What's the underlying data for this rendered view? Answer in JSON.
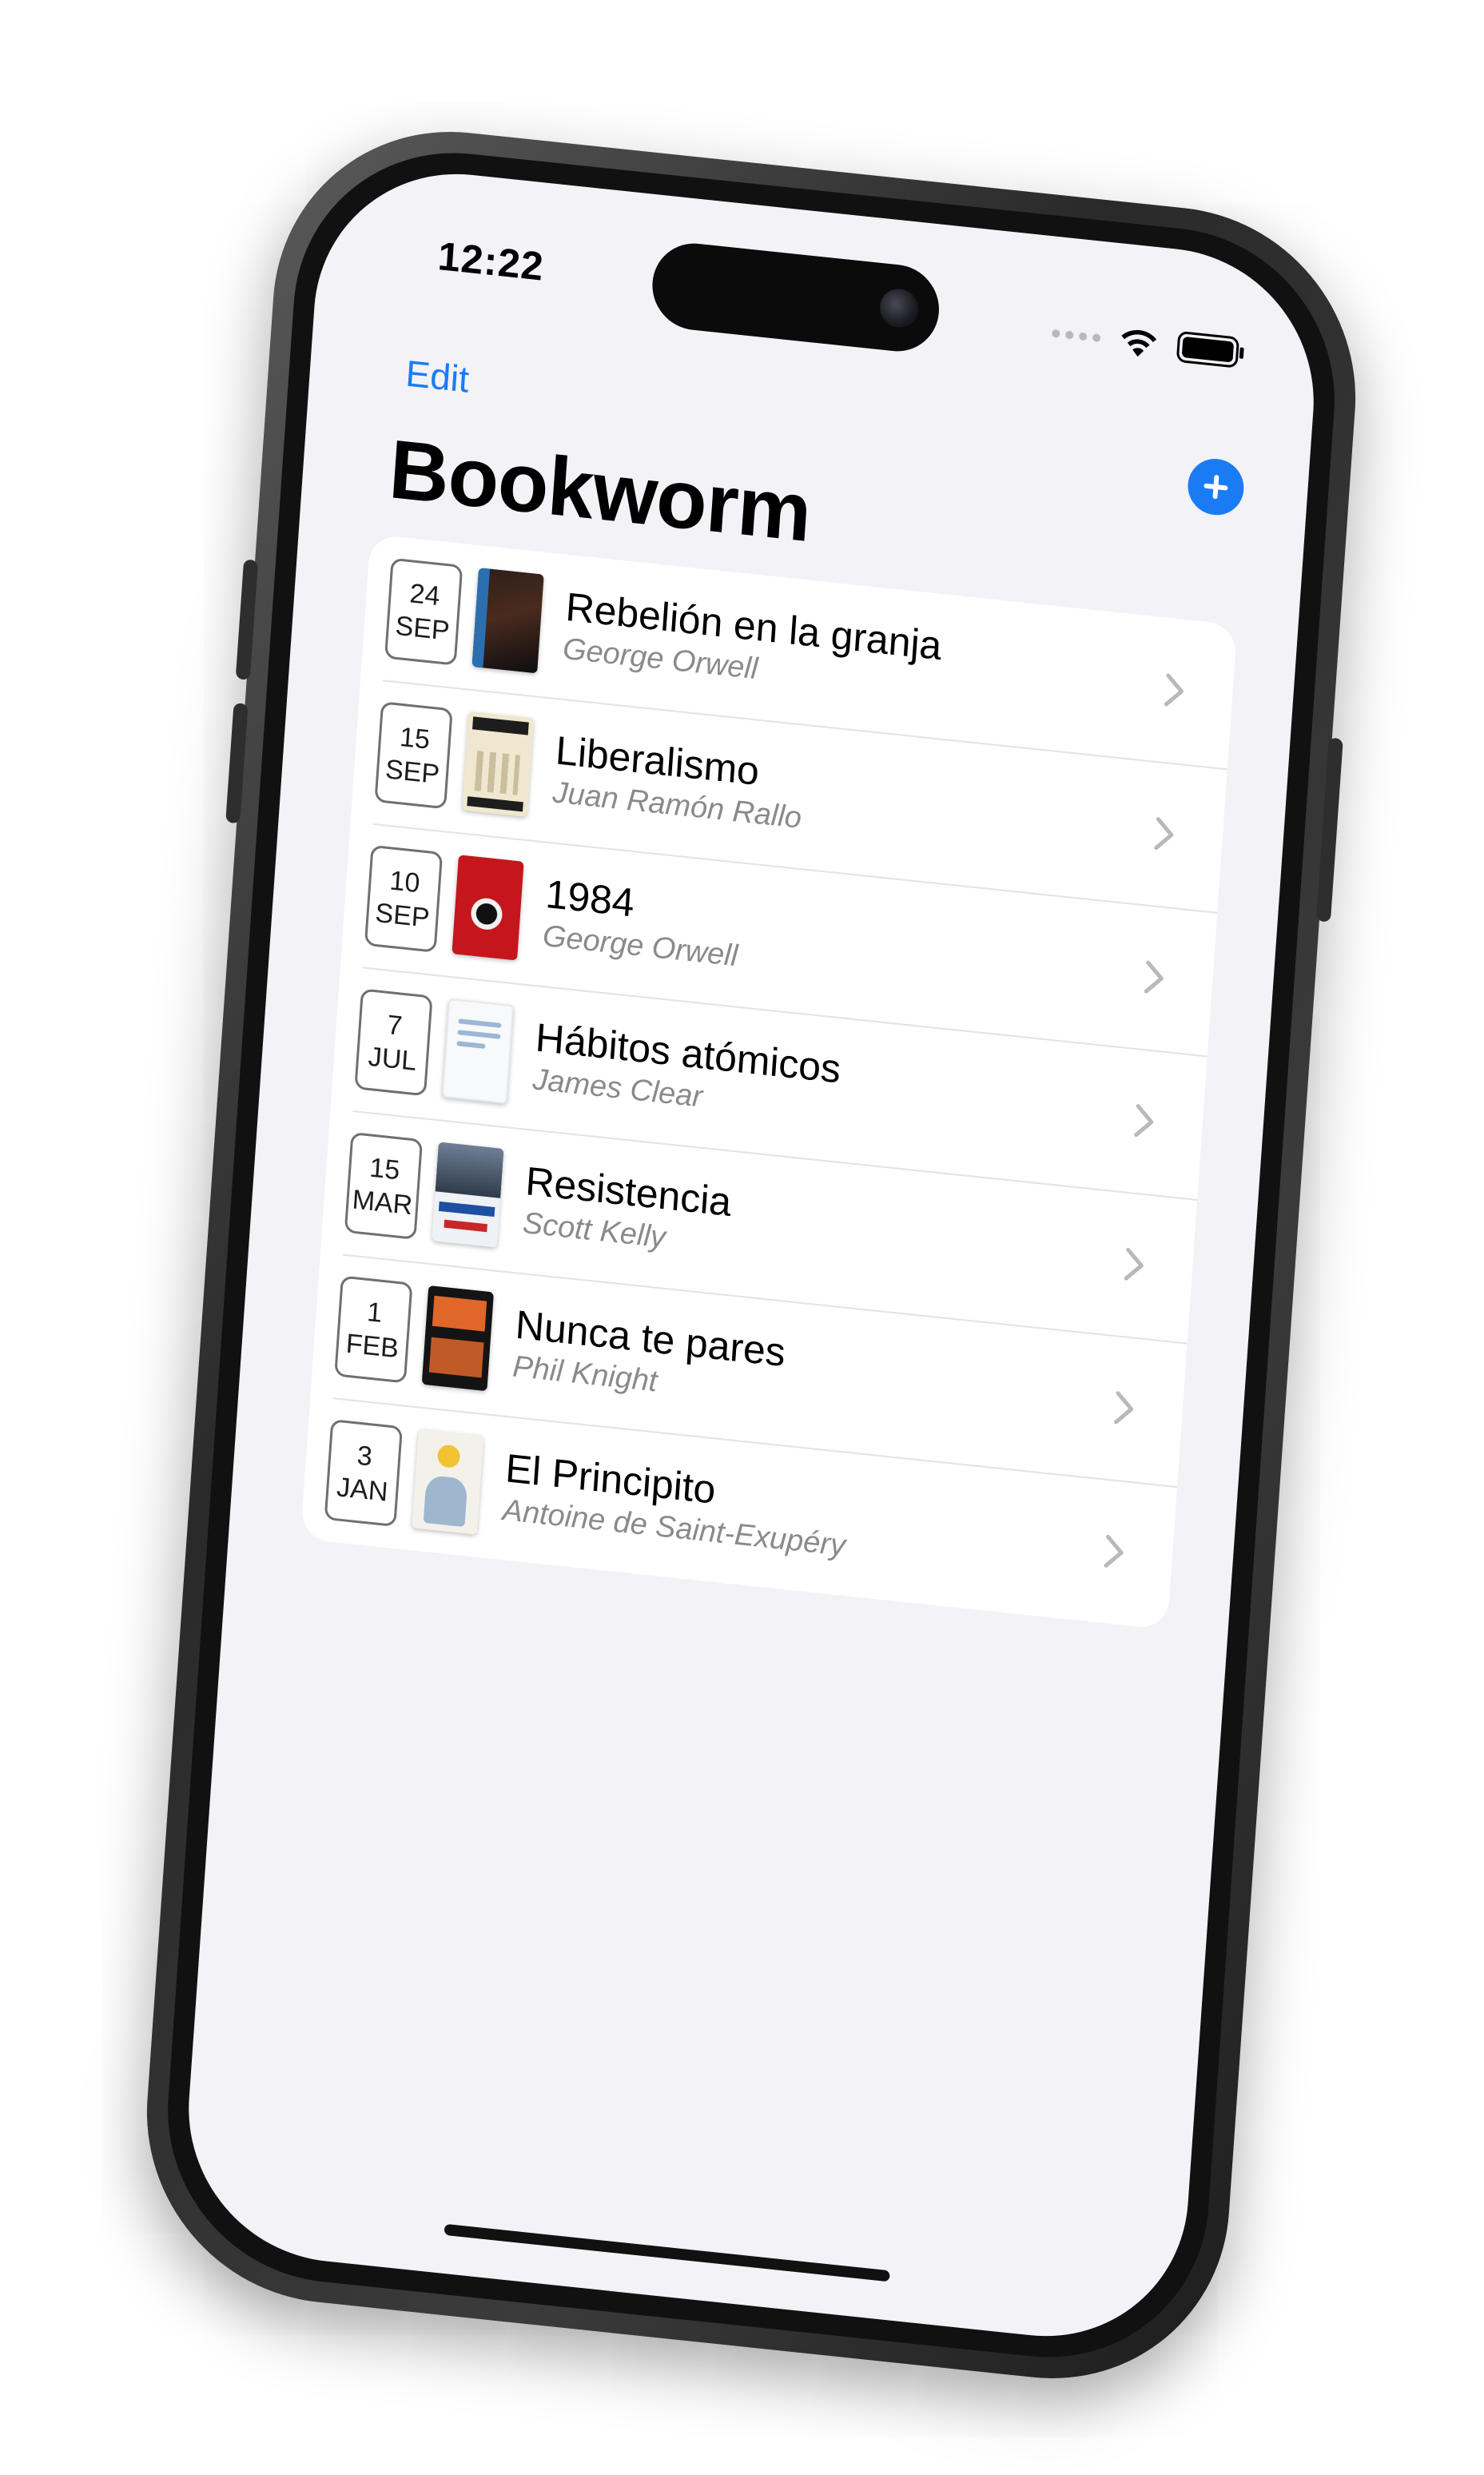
{
  "status_bar": {
    "time": "12:22",
    "signal_icon": "signal-dots-icon",
    "wifi_icon": "wifi-icon",
    "battery_icon": "battery-icon"
  },
  "nav": {
    "edit_label": "Edit",
    "add_icon": "plus-circle-icon",
    "title": "Bookworm"
  },
  "colors": {
    "accent": "#1a7cf5",
    "background": "#f2f2f7",
    "secondary_text": "#8a8a8e"
  },
  "books": [
    {
      "day": "24",
      "month": "SEP",
      "title": "Rebelión en la granja",
      "author": "George Orwell"
    },
    {
      "day": "15",
      "month": "SEP",
      "title": "Liberalismo",
      "author": "Juan Ramón Rallo"
    },
    {
      "day": "10",
      "month": "SEP",
      "title": "1984",
      "author": "George Orwell"
    },
    {
      "day": "7",
      "month": "JUL",
      "title": "Hábitos atómicos",
      "author": "James Clear"
    },
    {
      "day": "15",
      "month": "MAR",
      "title": "Resistencia",
      "author": "Scott Kelly"
    },
    {
      "day": "1",
      "month": "FEB",
      "title": "Nunca te pares",
      "author": "Phil Knight"
    },
    {
      "day": "3",
      "month": "JAN",
      "title": "El Principito",
      "author": "Antoine de Saint-Exupéry"
    }
  ]
}
